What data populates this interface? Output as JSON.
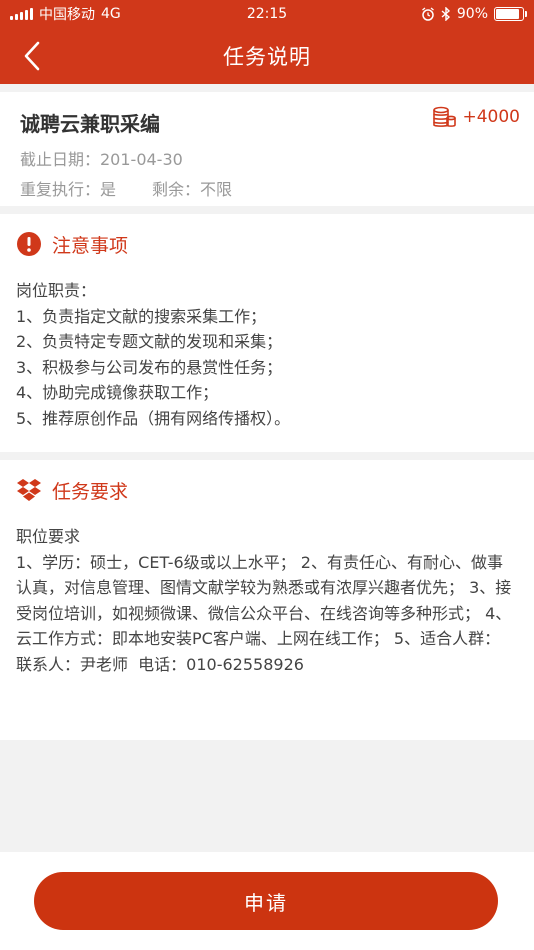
{
  "status_bar": {
    "carrier": "中国移动",
    "network": "4G",
    "time": "22:15",
    "battery": "90%",
    "battery_level": 0.9
  },
  "nav": {
    "title": "任务说明",
    "back_icon": "chevron-left-icon"
  },
  "task": {
    "title": "诚聘云兼职采编",
    "reward": "+4000",
    "deadline": "截止日期：201-04-30",
    "repeat": "重复执行：是",
    "remaining": "剩余：不限"
  },
  "notice": {
    "title": "注意事项",
    "icon": "exclamation-circle-icon",
    "body": "岗位职责：\n1、负责指定文献的搜索采集工作；\n2、负责特定专题文献的发现和采集；\n3、积极参与公司发布的悬赏性任务；\n4、协助完成镜像获取工作；\n5、推荐原创作品（拥有网络传播权）。"
  },
  "requirements": {
    "title": "任务要求",
    "icon": "dropbox-icon",
    "body": "职位要求\n1、学历：硕士，CET-6级或以上水平； 2、有责任心、有耐心、做事认真，对信息管理、图情文献学较为熟悉或有浓厚兴趣者优先； 3、接受岗位培训，如视频微课、微信公众平台、在线咨询等多种形式； 4、云工作方式：即本地安装PC客户端、上网在线工作； 5、适合人群：\n联系人：尹老师  电话：010-62558926"
  },
  "footer": {
    "apply_label": "申请"
  },
  "colors": {
    "brand": "#d0381a",
    "button": "#cc3410"
  }
}
